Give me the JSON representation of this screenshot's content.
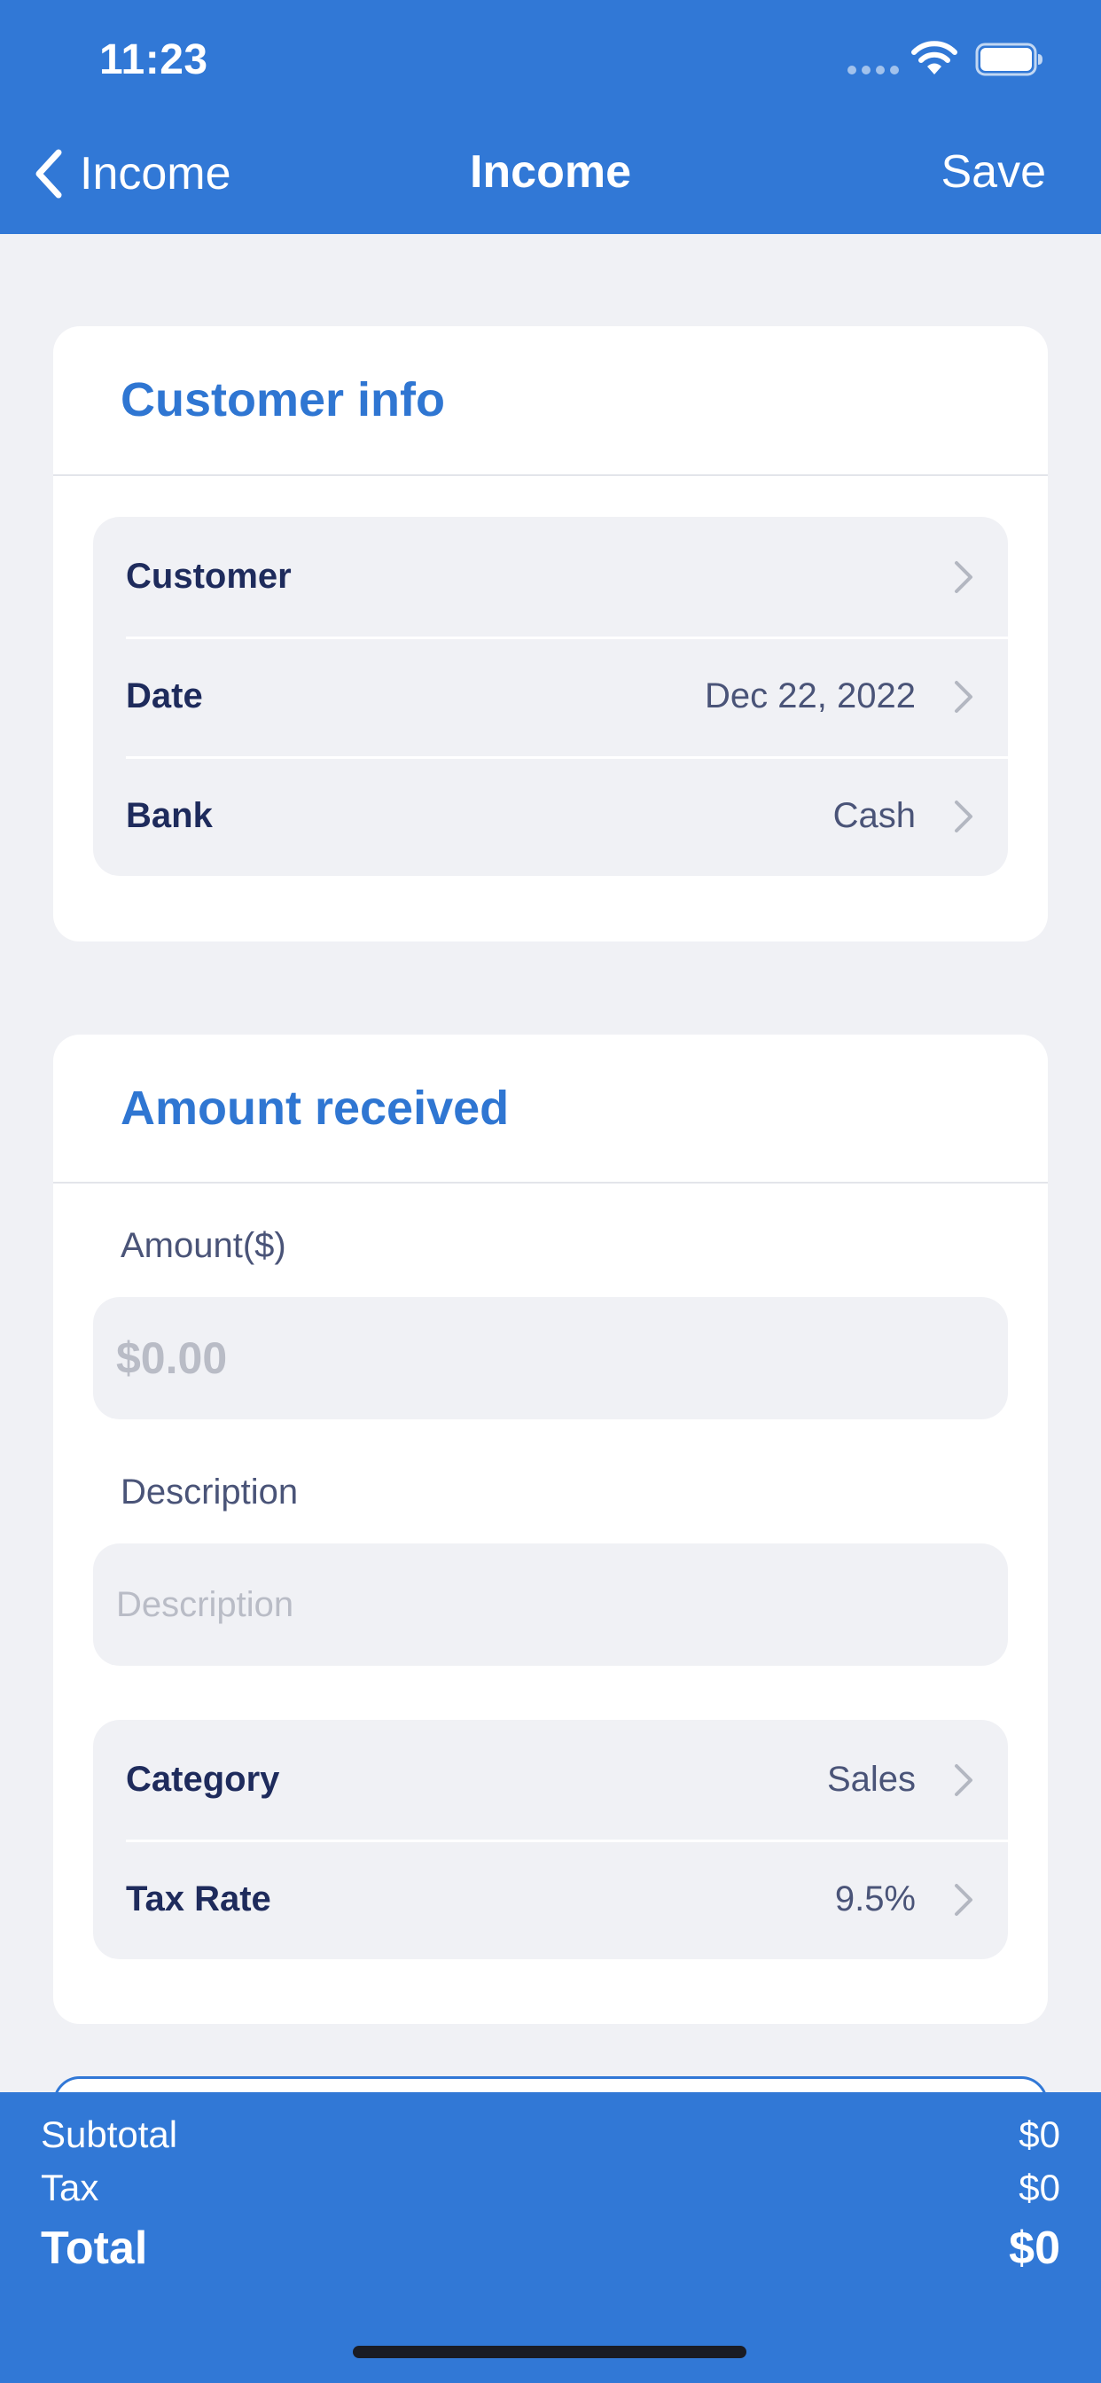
{
  "status_bar": {
    "time": "11:23"
  },
  "nav": {
    "back_label": "Income",
    "title": "Income",
    "save_label": "Save"
  },
  "customer_info": {
    "title": "Customer info",
    "rows": [
      {
        "label": "Customer",
        "value": ""
      },
      {
        "label": "Date",
        "value": "Dec 22, 2022"
      },
      {
        "label": "Bank",
        "value": "Cash"
      }
    ]
  },
  "amount_received": {
    "title": "Amount received",
    "amount_label": "Amount($)",
    "amount_placeholder": "$0.00",
    "description_label": "Description",
    "description_placeholder": "Description",
    "rows": [
      {
        "label": "Category",
        "value": "Sales"
      },
      {
        "label": "Tax Rate",
        "value": "9.5%"
      }
    ]
  },
  "summary": {
    "subtotal_label": "Subtotal",
    "subtotal_value": "$0",
    "tax_label": "Tax",
    "tax_value": "$0",
    "total_label": "Total",
    "total_value": "$0"
  },
  "colors": {
    "accent": "#3178d6",
    "background": "#f0f1f5",
    "text_dark": "#1e2b5c"
  }
}
